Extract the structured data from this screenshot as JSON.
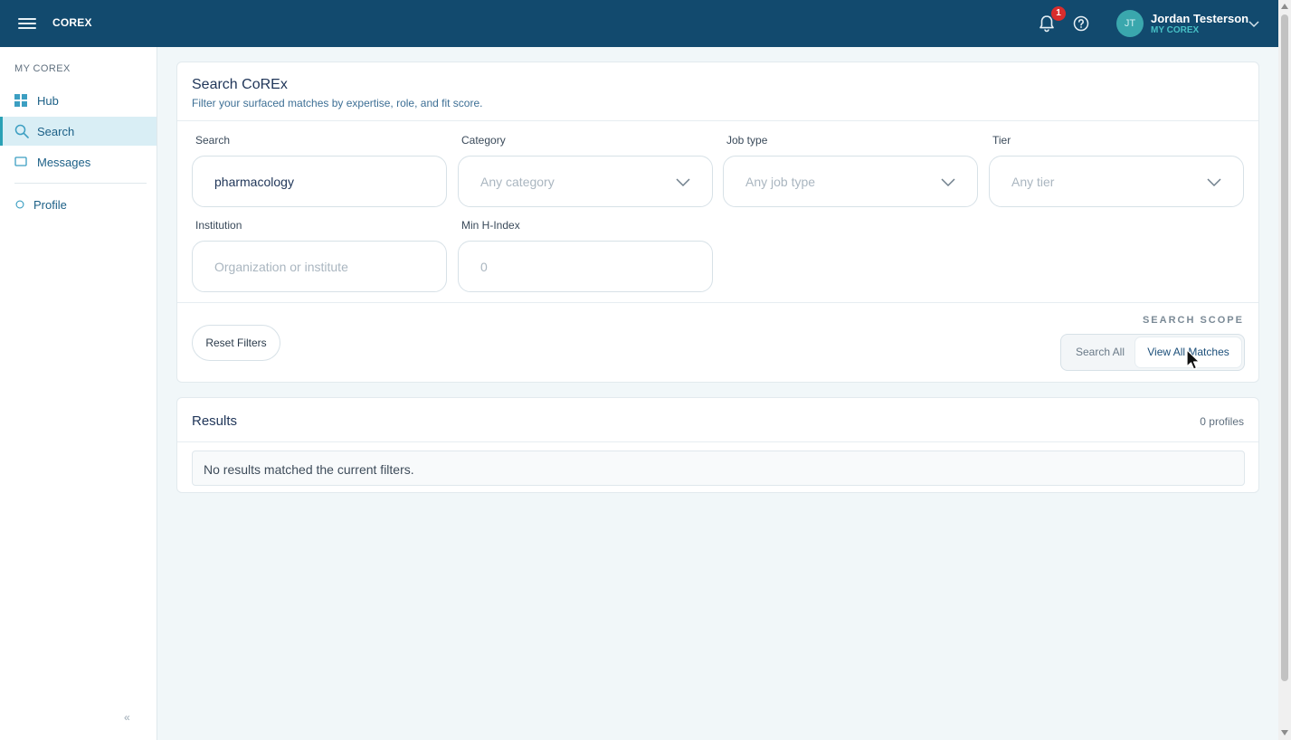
{
  "header": {
    "brand": "COREX",
    "notification_count": "1",
    "user_initials": "JT",
    "user_name": "Jordan Testerson",
    "user_subtitle": "MY COREX"
  },
  "sidebar": {
    "section_label": "MY COREX",
    "items": [
      {
        "label": "Hub",
        "icon": "grid-icon"
      },
      {
        "label": "Search",
        "icon": "search-icon",
        "active": true
      },
      {
        "label": "Messages",
        "icon": "message-icon"
      },
      {
        "label": "Profile",
        "icon": "circle-icon"
      }
    ],
    "collapse_glyph": "«"
  },
  "search_card": {
    "title": "Search CoREx",
    "subtitle": "Filter your surfaced matches by expertise, role, and fit score.",
    "fields": {
      "search": {
        "label": "Search",
        "value": "pharmacology"
      },
      "category": {
        "label": "Category",
        "placeholder": "Any category"
      },
      "job_type": {
        "label": "Job type",
        "placeholder": "Any job type"
      },
      "tier": {
        "label": "Tier",
        "placeholder": "Any tier"
      },
      "institution": {
        "label": "Institution",
        "placeholder": "Organization or institute"
      },
      "min_h_index": {
        "label": "Min H-Index",
        "placeholder": "0"
      }
    },
    "reset_label": "Reset Filters",
    "scope_label": "SEARCH SCOPE",
    "scope_options": [
      "Search All",
      "View All Matches"
    ],
    "scope_selected": "View All Matches"
  },
  "results": {
    "title": "Results",
    "count": "0 profiles",
    "empty_message": "No results matched the current filters."
  },
  "colors": {
    "topbar": "#124a6e",
    "accent": "#2aa1b5",
    "avatar": "#3aa7ad",
    "badge": "#d92d2d"
  }
}
